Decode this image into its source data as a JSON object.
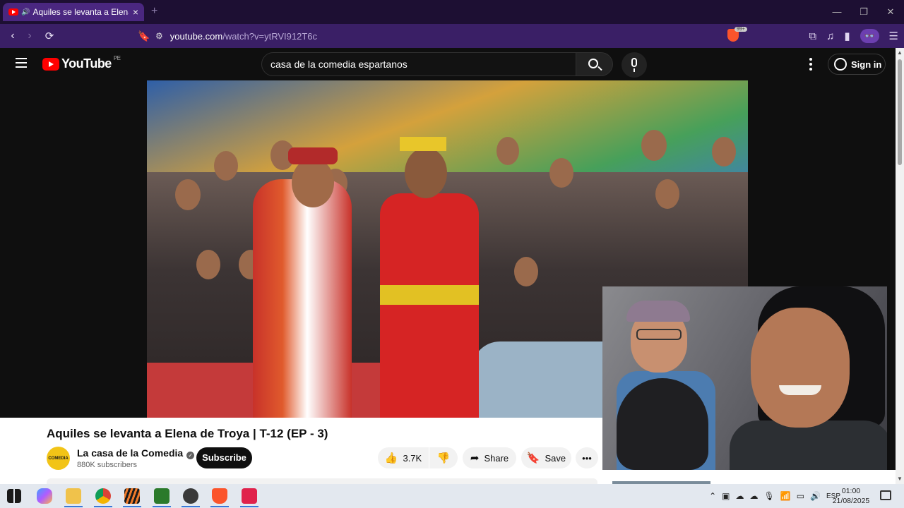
{
  "browser": {
    "tab_title": "Aquiles se levanta a Elena de",
    "tab_close": "×",
    "new_tab": "+",
    "url_host": "youtube.com",
    "url_path": "/watch?v=ytRVI912T6c",
    "shield_badge": "99+"
  },
  "youtube": {
    "logo_text": "YouTube",
    "country_code": "PE",
    "search_value": "casa de la comedia espartanos",
    "sign_in_label": "Sign in"
  },
  "video_info": {
    "title": "Aquiles se levanta a Elena de Troya | T-12 (EP - 3)",
    "channel_name": "La casa de la Comedia",
    "channel_avatar_text": "COMEDIA",
    "subscribers": "880K subscribers",
    "subscribe_label": "Subscribe",
    "like_count": "3.7K",
    "share_label": "Share",
    "save_label": "Save"
  },
  "taskbar": {
    "language": "ESP",
    "time": "01:00",
    "date": "21/08/2025"
  },
  "colors": {
    "brand_red": "#ff0000",
    "browser_purple": "#3a1f66",
    "tab_purple": "#4a2780"
  }
}
